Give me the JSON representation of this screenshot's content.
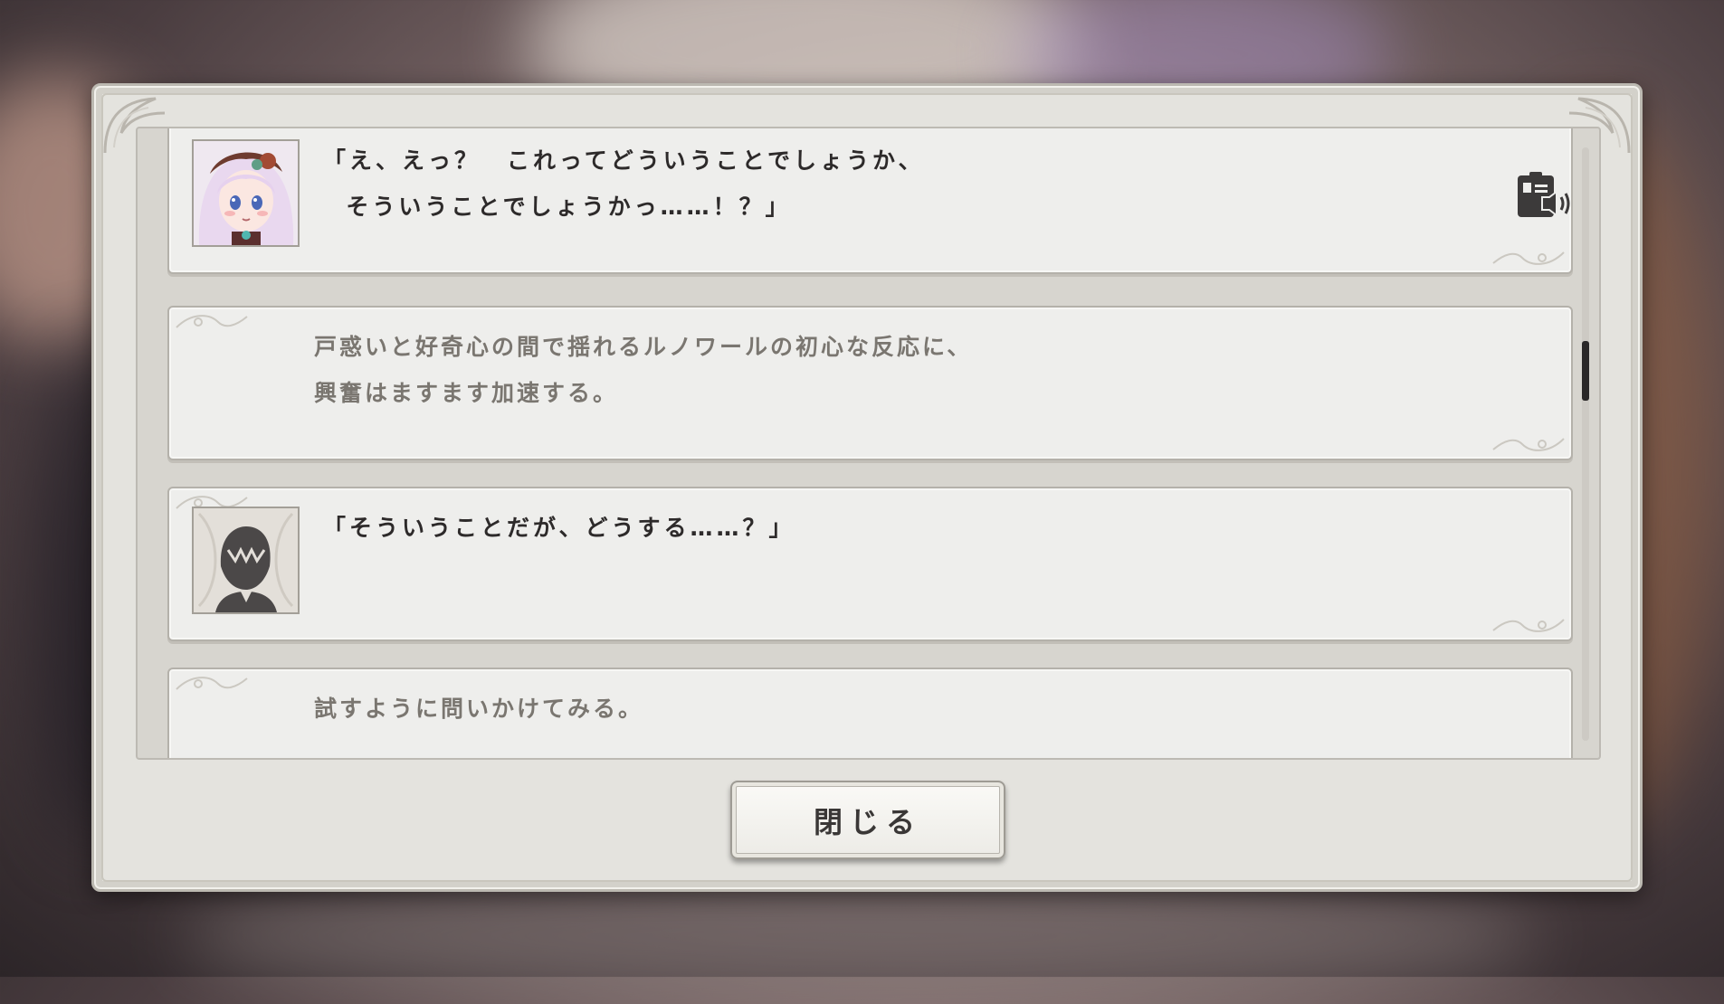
{
  "dialog": {
    "close_label": "閉じる"
  },
  "log": {
    "entries": [
      {
        "type": "speech",
        "speaker_icon": "girl-portrait",
        "text": "「え、えっ？　これってどういうことでしょうか、\n  そういうことでしょうかっ……！？」",
        "voice_icon": "voice-replay-icon"
      },
      {
        "type": "narration",
        "text": "戸惑いと好奇心の間で揺れるルノワールの初心な反応に、\n興奮はますます加速する。"
      },
      {
        "type": "speech",
        "speaker_icon": "player-silhouette",
        "text": "「そういうことだが、どうする……？」"
      },
      {
        "type": "narration",
        "text": "試すように問いかけてみる。"
      }
    ]
  },
  "scrollbar": {
    "position": 0.37
  }
}
